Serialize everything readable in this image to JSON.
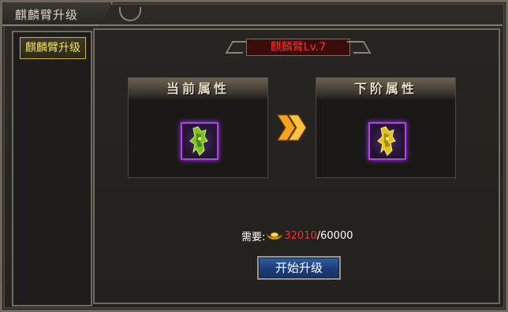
{
  "window": {
    "title": "麒麟臂升级"
  },
  "sidebar": {
    "items": [
      {
        "label": "麒麟臂升级",
        "selected": true
      }
    ]
  },
  "main": {
    "level_label": "麒麟臂Lv.7",
    "current_panel": {
      "title": "当前属性",
      "icon": "green-qilin-arm-icon"
    },
    "next_panel": {
      "title": "下阶属性",
      "icon": "gold-qilin-arm-icon"
    },
    "arrow_icon": "double-chevron-right-icon",
    "requirement": {
      "label": "需要:",
      "currency_icon": "gold-ingot-icon",
      "have": "32010",
      "separator": "/",
      "need": "60000"
    },
    "upgrade_button": "开始升级"
  },
  "colors": {
    "accent_red": "#ff2b2b",
    "sidebar_selected_text": "#f3e35a",
    "slot_border_purple": "#b53cf0",
    "button_blue": "#2e5fa3"
  }
}
